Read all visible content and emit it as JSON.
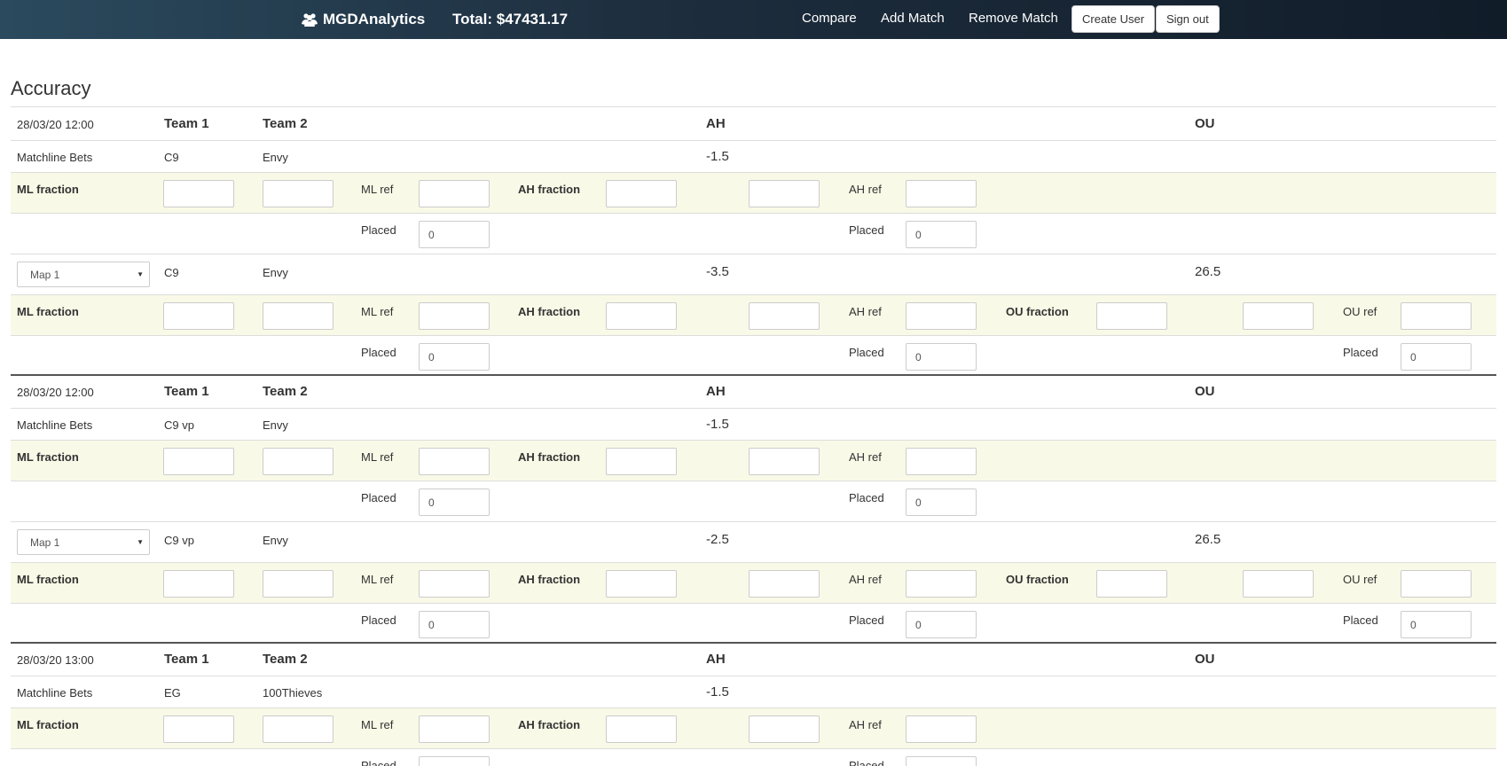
{
  "nav": {
    "brand": "MGDAnalytics",
    "brand_icon": "users-icon",
    "total": "Total: $47431.17",
    "links": [
      "Compare",
      "Add Match",
      "Remove Match"
    ],
    "create_user": "Create User",
    "sign_out": "Sign out"
  },
  "page_title": "Accuracy",
  "labels": {
    "team1": "Team 1",
    "team2": "Team 2",
    "ah": "AH",
    "ou": "OU",
    "matchline_bets": "Matchline Bets",
    "ml_fraction": "ML fraction",
    "ml_ref": "ML ref",
    "ah_fraction": "AH fraction",
    "ah_ref": "AH ref",
    "ou_fraction": "OU fraction",
    "ou_ref": "OU ref",
    "placed": "Placed",
    "placed_value": "0"
  },
  "matches": [
    {
      "date": "28/03/20 12:00",
      "team1": "C9",
      "team2": "Envy",
      "ah": "-1.5",
      "map": {
        "selected": "Map 1",
        "team1": "C9",
        "team2": "Envy",
        "ah": "-3.5",
        "ou": "26.5"
      }
    },
    {
      "date": "28/03/20 12:00",
      "team1": "C9 vp",
      "team2": "Envy",
      "ah": "-1.5",
      "map": {
        "selected": "Map 1",
        "team1": "C9 vp",
        "team2": "Envy",
        "ah": "-2.5",
        "ou": "26.5"
      }
    },
    {
      "date": "28/03/20 13:00",
      "team1": "EG",
      "team2": "100Thieves",
      "ah": "-1.5"
    }
  ]
}
